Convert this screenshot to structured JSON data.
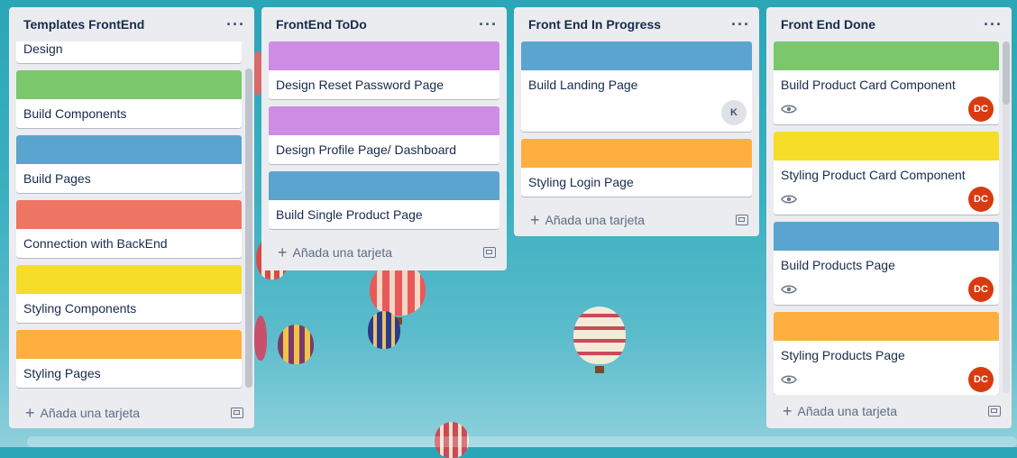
{
  "colors": {
    "green": "#7bc86c",
    "purple": "#cd8de5",
    "blue": "#5ba4cf",
    "red": "#ef7564",
    "yellow": "#f5dd29",
    "orange": "#ffaf3f",
    "avatar": "#d93a10"
  },
  "add_card_label": "Añada una tarjeta",
  "lists": [
    {
      "title": "Templates FrontEnd",
      "cards": [
        {
          "title": "Design",
          "label": ""
        },
        {
          "title": "Build Components",
          "label": "green"
        },
        {
          "title": "Build Pages",
          "label": "blue"
        },
        {
          "title": "Connection with BackEnd",
          "label": "red"
        },
        {
          "title": "Styling Components",
          "label": "yellow"
        },
        {
          "title": "Styling Pages",
          "label": "orange"
        }
      ]
    },
    {
      "title": "FrontEnd ToDo",
      "cards": [
        {
          "title": "Design Reset Password Page",
          "label": "purple"
        },
        {
          "title": "Design Profile Page/ Dashboard",
          "label": "purple"
        },
        {
          "title": "Build Single Product Page",
          "label": "blue"
        }
      ]
    },
    {
      "title": "Front End In Progress",
      "cards": [
        {
          "title": "Build Landing Page",
          "label": "blue",
          "avatar": "K"
        },
        {
          "title": "Styling Login Page",
          "label": "orange"
        }
      ]
    },
    {
      "title": "Front End Done",
      "cards": [
        {
          "title": "Build Product Card Component",
          "label": "green",
          "avatar": "DC",
          "watch": true
        },
        {
          "title": "Styling Product Card Component",
          "label": "yellow",
          "avatar": "DC",
          "watch": true
        },
        {
          "title": "Build Products Page",
          "label": "blue",
          "avatar": "DC",
          "watch": true
        },
        {
          "title": "Styling Products Page",
          "label": "orange",
          "avatar": "DC",
          "watch": true
        }
      ]
    }
  ]
}
